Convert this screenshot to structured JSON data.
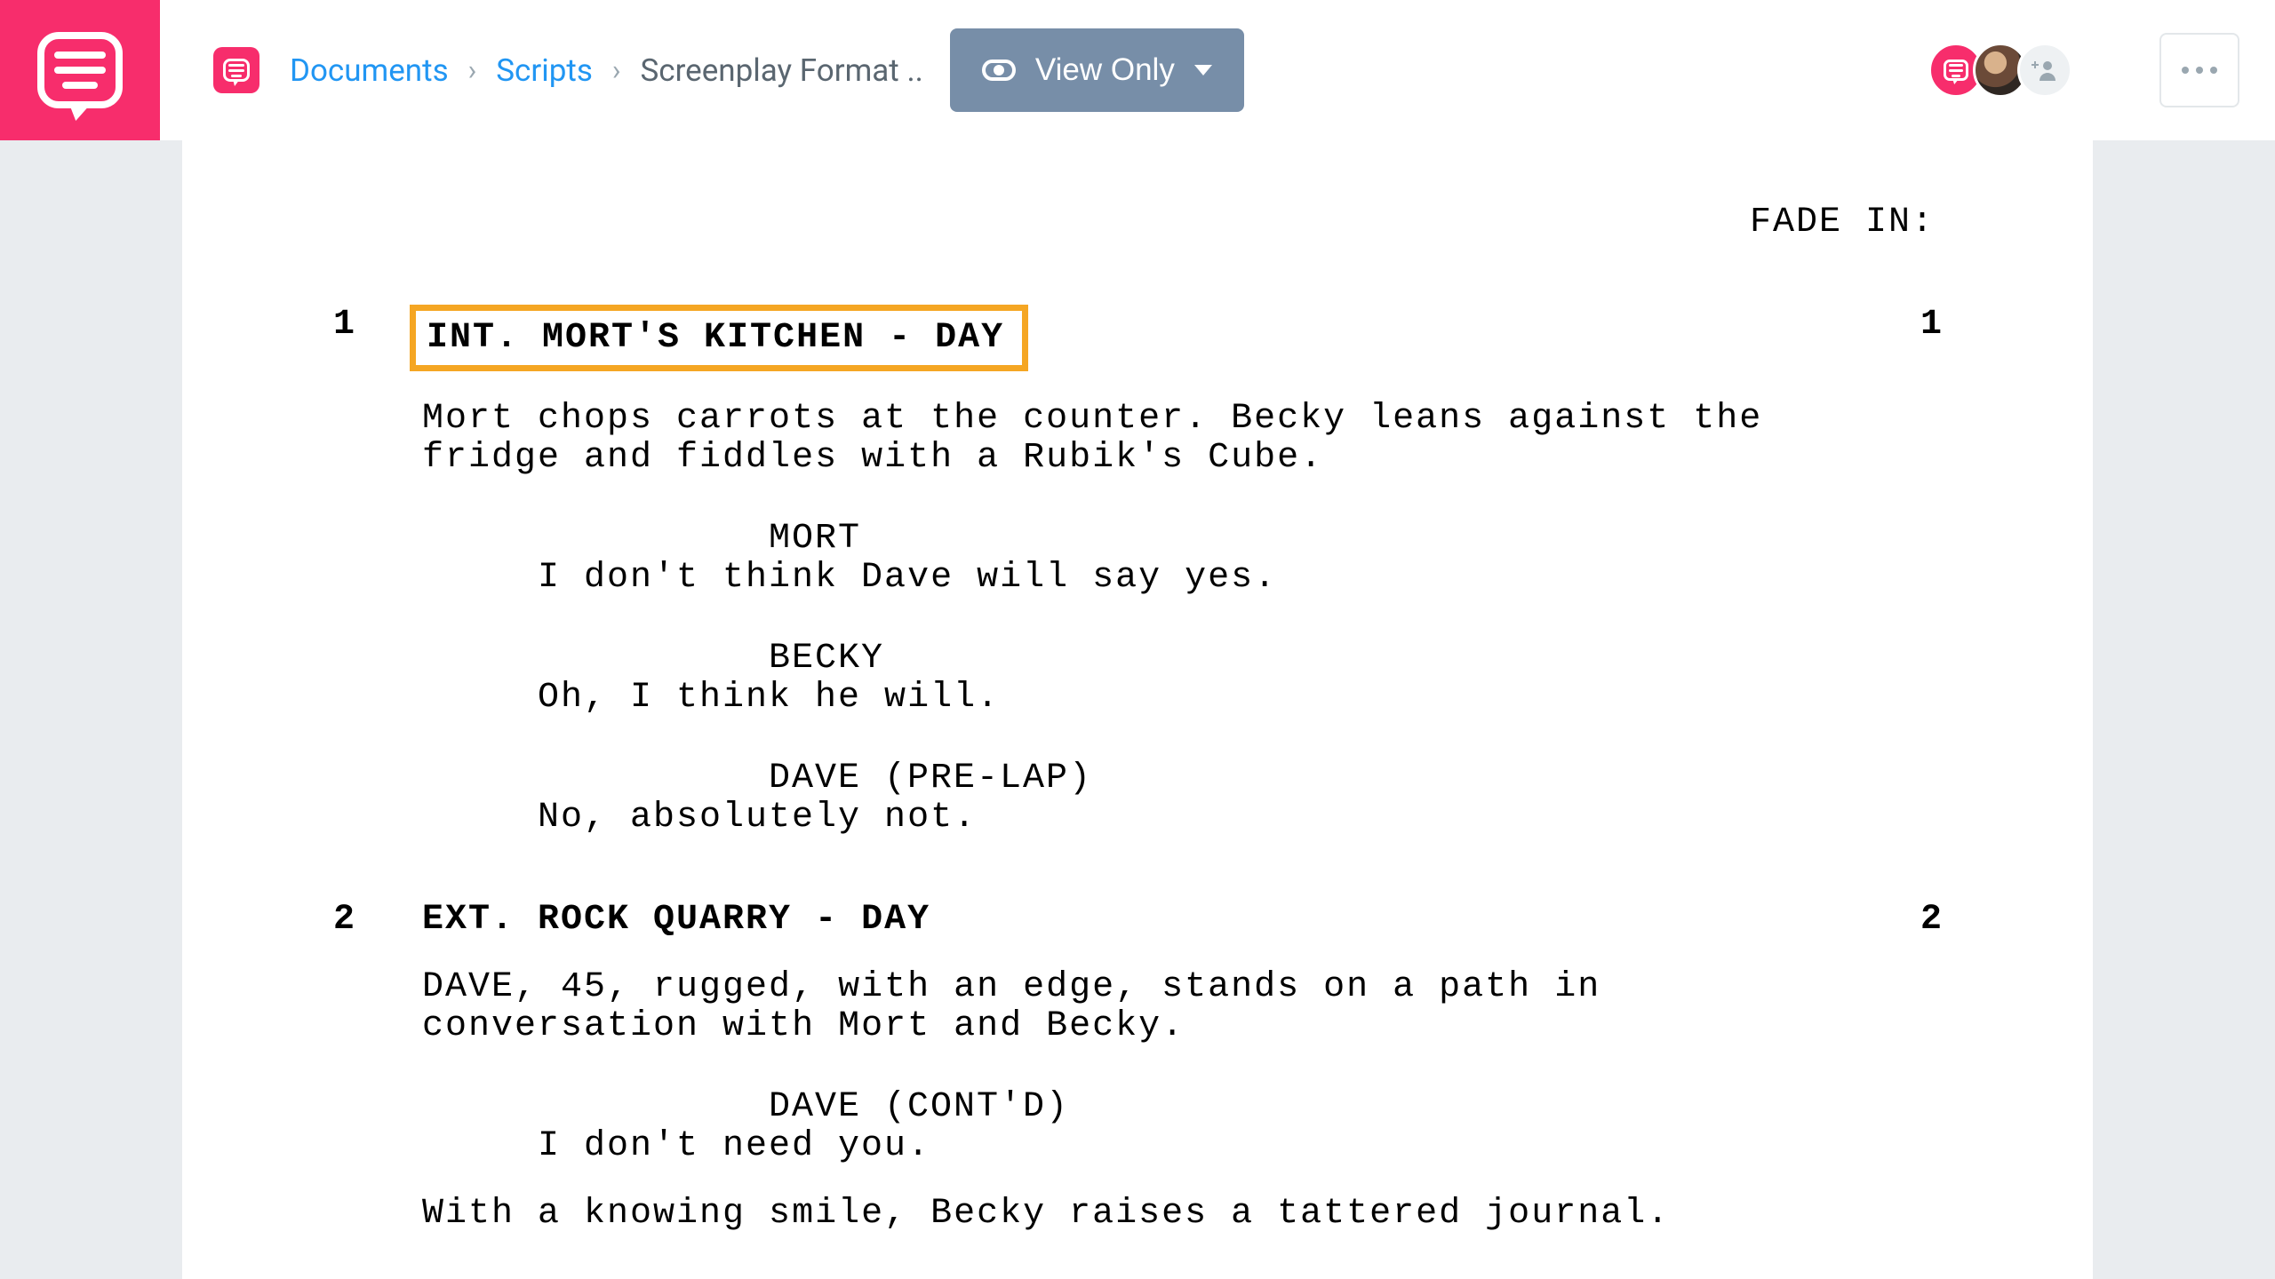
{
  "header": {
    "breadcrumb": {
      "documents": "Documents",
      "scripts": "Scripts",
      "current": "Screenplay Format .."
    },
    "view_button_label": "View Only"
  },
  "script": {
    "fade_in": "FADE IN:",
    "scenes": [
      {
        "num": "1",
        "heading": "INT. MORT'S KITCHEN - DAY",
        "highlighted": true,
        "action": "Mort chops carrots at the counter. Becky leans against the fridge and fiddles with a Rubik's Cube.",
        "dialogue": [
          {
            "character": "MORT",
            "line": "I don't think Dave will say yes."
          },
          {
            "character": "BECKY",
            "line": "Oh, I think he will."
          },
          {
            "character": "DAVE (PRE-LAP)",
            "line": "No, absolutely not."
          }
        ]
      },
      {
        "num": "2",
        "heading": "EXT. ROCK QUARRY - DAY",
        "highlighted": false,
        "action": "DAVE, 45, rugged, with an edge, stands on a path in conversation with Mort and Becky.",
        "dialogue": [
          {
            "character": "DAVE (CONT'D)",
            "line": "I don't need you."
          }
        ],
        "action2": "With a knowing smile, Becky raises a tattered journal."
      }
    ]
  }
}
